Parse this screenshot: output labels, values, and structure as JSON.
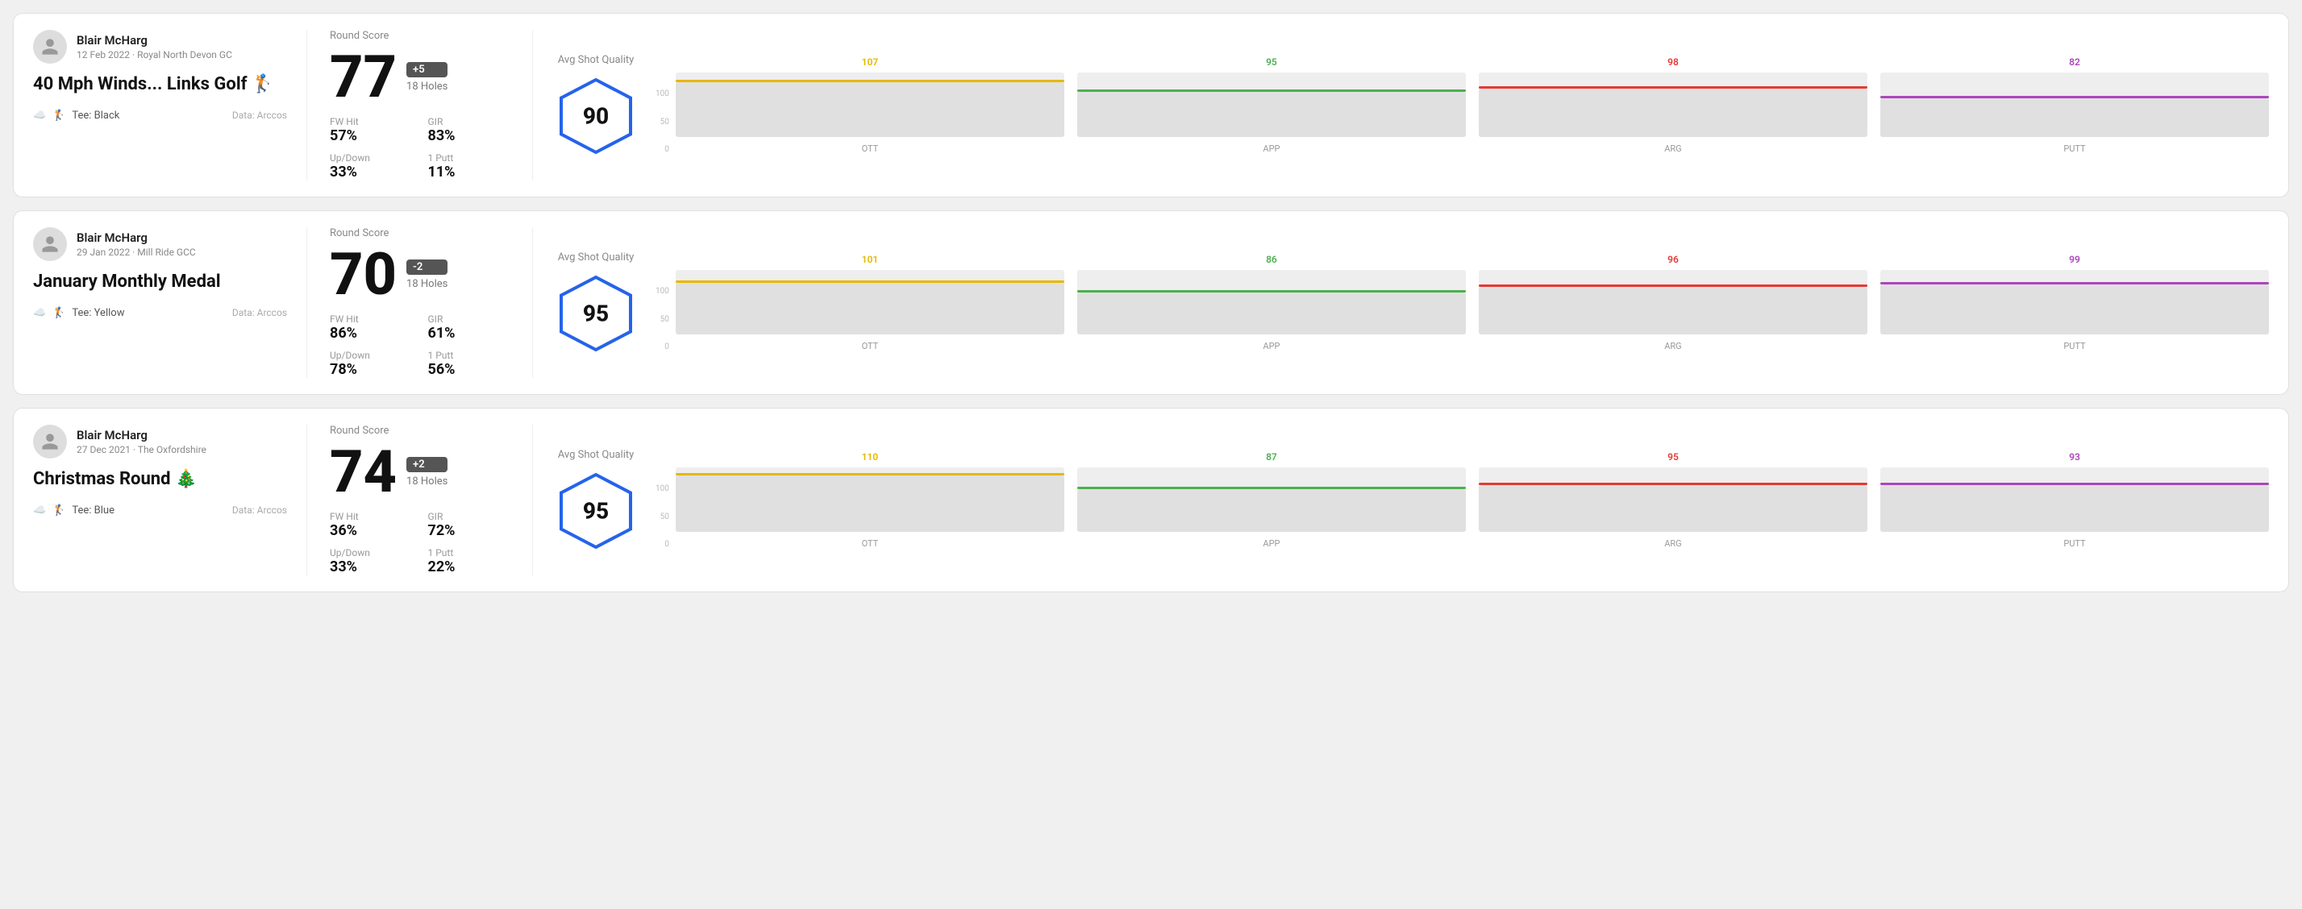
{
  "rounds": [
    {
      "id": "round1",
      "user": {
        "name": "Blair McHarg",
        "date": "12 Feb 2022",
        "course": "Royal North Devon GC"
      },
      "title": "40 Mph Winds... Links Golf 🏌️",
      "tee": "Black",
      "dataSource": "Data: Arccos",
      "score": "77",
      "scoreDiff": "+5",
      "holes": "18 Holes",
      "fwHitLabel": "FW Hit",
      "girLabel": "GIR",
      "upDownLabel": "Up/Down",
      "onePuttLabel": "1 Putt",
      "fwHit": "57%",
      "gir": "83%",
      "upDown": "33%",
      "onePutt": "11%",
      "avgShotQualityLabel": "Avg Shot Quality",
      "avgShotQuality": "90",
      "roundScoreLabel": "Round Score",
      "chart": {
        "bars": [
          {
            "label": "OTT",
            "value": 107,
            "color": "#e6b800",
            "pct": 85
          },
          {
            "label": "APP",
            "value": 95,
            "color": "#4caf50",
            "pct": 70
          },
          {
            "label": "ARG",
            "value": 98,
            "color": "#e53935",
            "pct": 75
          },
          {
            "label": "PUTT",
            "value": 82,
            "color": "#ab47bc",
            "pct": 60
          }
        ]
      }
    },
    {
      "id": "round2",
      "user": {
        "name": "Blair McHarg",
        "date": "29 Jan 2022",
        "course": "Mill Ride GCC"
      },
      "title": "January Monthly Medal",
      "tee": "Yellow",
      "dataSource": "Data: Arccos",
      "score": "70",
      "scoreDiff": "-2",
      "holes": "18 Holes",
      "fwHitLabel": "FW Hit",
      "girLabel": "GIR",
      "upDownLabel": "Up/Down",
      "onePuttLabel": "1 Putt",
      "fwHit": "86%",
      "gir": "61%",
      "upDown": "78%",
      "onePutt": "56%",
      "avgShotQualityLabel": "Avg Shot Quality",
      "avgShotQuality": "95",
      "roundScoreLabel": "Round Score",
      "chart": {
        "bars": [
          {
            "label": "OTT",
            "value": 101,
            "color": "#e6b800",
            "pct": 80
          },
          {
            "label": "APP",
            "value": 86,
            "color": "#4caf50",
            "pct": 65
          },
          {
            "label": "ARG",
            "value": 96,
            "color": "#e53935",
            "pct": 74
          },
          {
            "label": "PUTT",
            "value": 99,
            "color": "#ab47bc",
            "pct": 77
          }
        ]
      }
    },
    {
      "id": "round3",
      "user": {
        "name": "Blair McHarg",
        "date": "27 Dec 2021",
        "course": "The Oxfordshire"
      },
      "title": "Christmas Round 🎄",
      "tee": "Blue",
      "dataSource": "Data: Arccos",
      "score": "74",
      "scoreDiff": "+2",
      "holes": "18 Holes",
      "fwHitLabel": "FW Hit",
      "girLabel": "GIR",
      "upDownLabel": "Up/Down",
      "onePuttLabel": "1 Putt",
      "fwHit": "36%",
      "gir": "72%",
      "upDown": "33%",
      "onePutt": "22%",
      "avgShotQualityLabel": "Avg Shot Quality",
      "avgShotQuality": "95",
      "roundScoreLabel": "Round Score",
      "chart": {
        "bars": [
          {
            "label": "OTT",
            "value": 110,
            "color": "#e6b800",
            "pct": 88
          },
          {
            "label": "APP",
            "value": 87,
            "color": "#4caf50",
            "pct": 66
          },
          {
            "label": "ARG",
            "value": 95,
            "color": "#e53935",
            "pct": 73
          },
          {
            "label": "PUTT",
            "value": 93,
            "color": "#ab47bc",
            "pct": 72
          }
        ]
      }
    }
  ]
}
